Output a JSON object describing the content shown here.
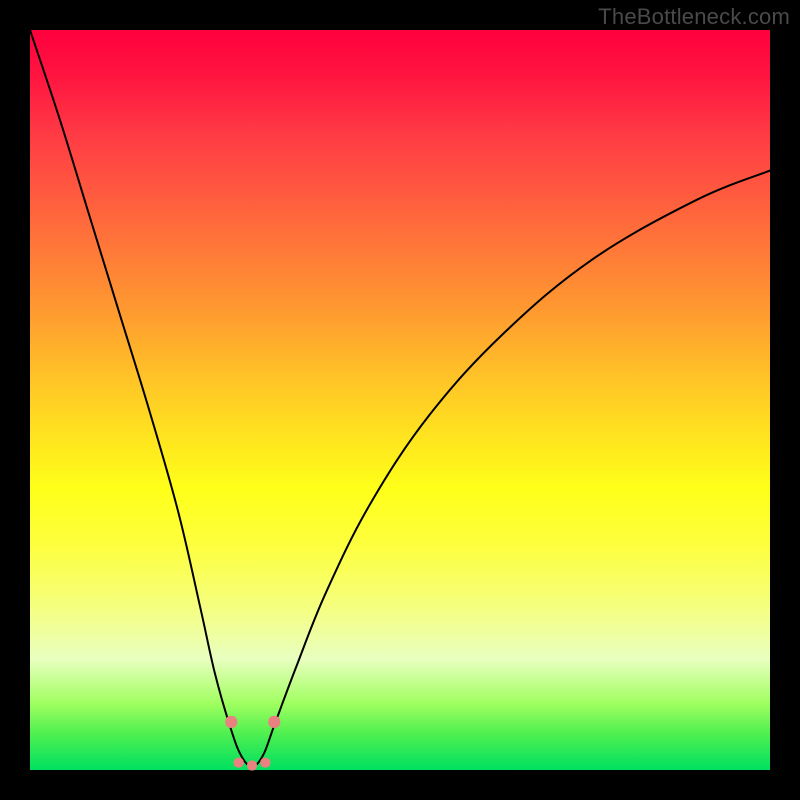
{
  "attribution": "TheBottleneck.com",
  "chart_data": {
    "type": "line",
    "title": "",
    "xlabel": "",
    "ylabel": "",
    "xlim": [
      0,
      100
    ],
    "ylim": [
      0,
      100
    ],
    "grid": false,
    "legend": false,
    "series": [
      {
        "name": "bottleneck-curve",
        "x": [
          0,
          4,
          8,
          12,
          16,
          20,
          23,
          25,
          27,
          28.5,
          30,
          31.5,
          33,
          36,
          40,
          46,
          54,
          64,
          76,
          90,
          100
        ],
        "y": [
          100,
          88,
          75,
          62,
          49,
          35,
          22,
          13,
          6,
          2,
          0.5,
          2,
          6,
          14,
          24,
          36,
          48,
          59,
          69,
          77,
          81
        ]
      }
    ],
    "markers": [
      {
        "name": "trough-marker-left",
        "x": 27.2,
        "y": 6.5,
        "color": "#e98181",
        "size": 12
      },
      {
        "name": "trough-marker-right",
        "x": 33.0,
        "y": 6.5,
        "color": "#e98181",
        "size": 12
      },
      {
        "name": "trough-base-left",
        "x": 28.2,
        "y": 1.0,
        "color": "#e98181",
        "size": 10
      },
      {
        "name": "trough-base-mid",
        "x": 30.0,
        "y": 0.6,
        "color": "#e98181",
        "size": 10
      },
      {
        "name": "trough-base-right",
        "x": 31.8,
        "y": 1.0,
        "color": "#e98181",
        "size": 10
      }
    ],
    "background": {
      "type": "vertical-gradient",
      "stops": [
        {
          "pos": 0.0,
          "color": "#ff003d"
        },
        {
          "pos": 0.3,
          "color": "#ff7a38"
        },
        {
          "pos": 0.62,
          "color": "#ffff19"
        },
        {
          "pos": 0.85,
          "color": "#e8ffc0"
        },
        {
          "pos": 1.0,
          "color": "#00e060"
        }
      ]
    }
  }
}
